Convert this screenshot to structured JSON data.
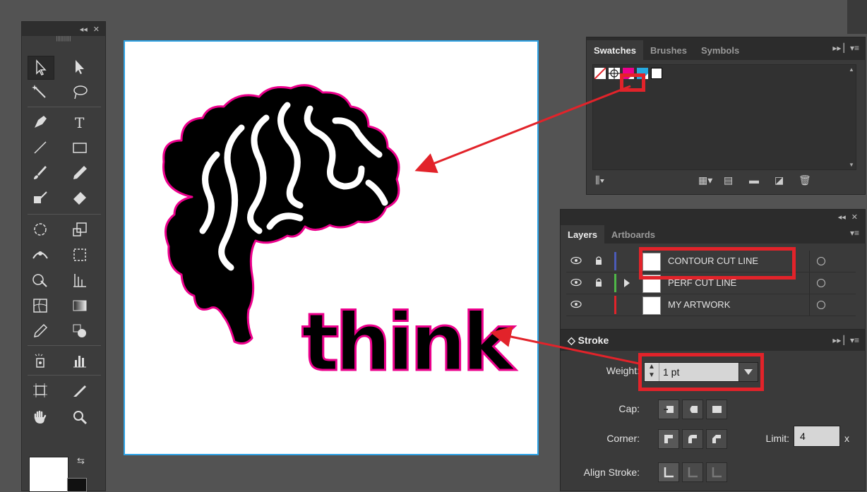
{
  "tools_panel": {
    "collapse_label": "◂◂",
    "close_label": "✕"
  },
  "artwork": {
    "text": "think",
    "fill_color": "#000000",
    "contour_color": "#ec008c"
  },
  "swatches_panel": {
    "tabs": [
      "Swatches",
      "Brushes",
      "Symbols"
    ],
    "active_tab": "Swatches",
    "swatch_colors": [
      "none",
      "registration",
      "#ec008c",
      "#27aae1",
      "#ffffff"
    ]
  },
  "layers_panel": {
    "tabs": [
      "Layers",
      "Artboards"
    ],
    "active_tab": "Layers",
    "layers": [
      {
        "name": "CONTOUR CUT LINE",
        "color": "#4b5bb8",
        "locked": true,
        "visible": true,
        "expandable": false
      },
      {
        "name": "PERF CUT LINE",
        "color": "#4fb848",
        "locked": true,
        "visible": true,
        "expandable": true
      },
      {
        "name": "MY ARTWORK",
        "color": "#e2232a",
        "locked": false,
        "visible": true,
        "expandable": false
      }
    ]
  },
  "stroke_panel": {
    "title": "Stroke",
    "weight_label": "Weight:",
    "weight_value": "1 pt",
    "cap_label": "Cap:",
    "corner_label": "Corner:",
    "limit_label": "Limit:",
    "limit_value": "4",
    "limit_suffix": "x",
    "align_label": "Align Stroke:"
  },
  "colors": {
    "highlight": "#e2232a",
    "artboard_border": "#2fa3e5"
  }
}
